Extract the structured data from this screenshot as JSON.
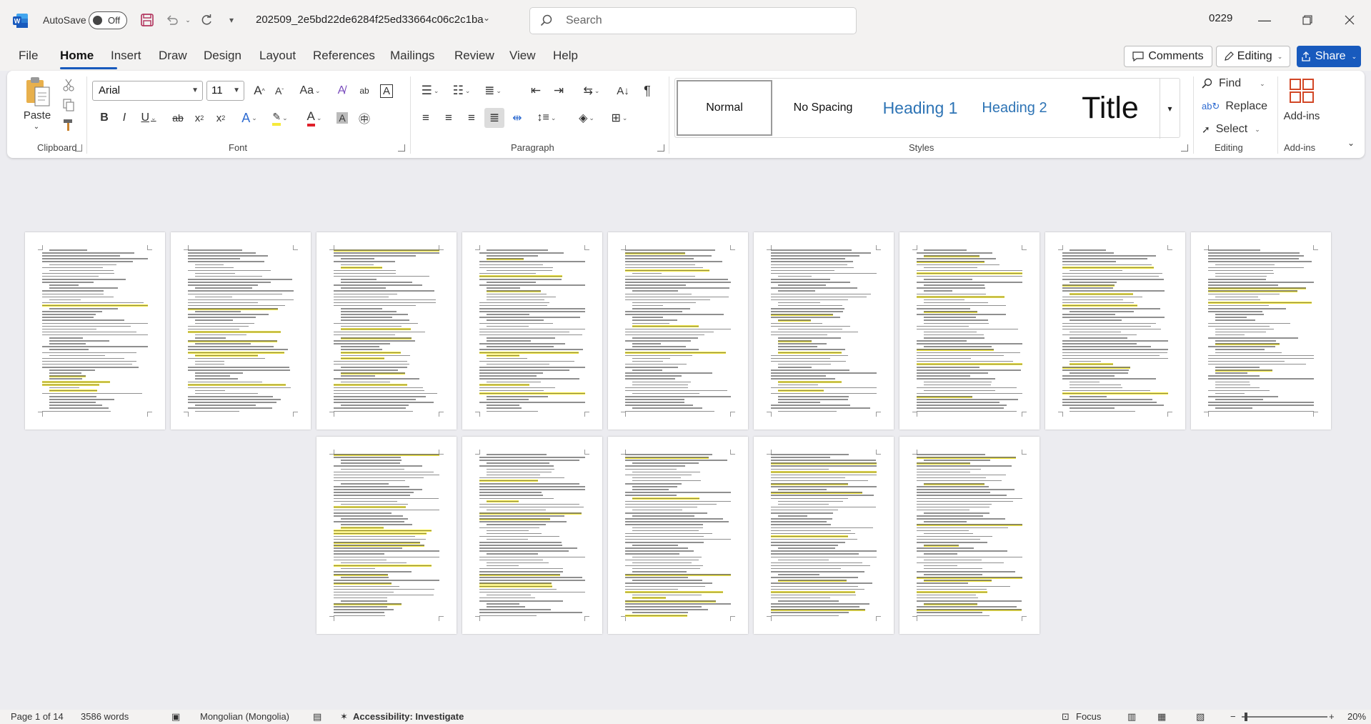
{
  "titlebar": {
    "autosave_label": "AutoSave",
    "autosave_state": "Off",
    "document_name": "202509_2e5bd22de6284f25ed33664c06c2c1ba",
    "search_placeholder": "Search",
    "user": "0229"
  },
  "menu": {
    "tabs": [
      "File",
      "Home",
      "Insert",
      "Draw",
      "Design",
      "Layout",
      "References",
      "Mailings",
      "Review",
      "View",
      "Help"
    ],
    "active_tab": "Home",
    "comments_label": "Comments",
    "editing_label": "Editing",
    "share_label": "Share"
  },
  "ribbon": {
    "clipboard": {
      "paste_label": "Paste",
      "group_label": "Clipboard"
    },
    "font": {
      "font_name": "Arial",
      "font_size": "11",
      "group_label": "Font"
    },
    "paragraph": {
      "group_label": "Paragraph"
    },
    "styles": {
      "items": [
        "Normal",
        "No Spacing",
        "Heading 1",
        "Heading 2",
        "Title"
      ],
      "selected": "Normal",
      "group_label": "Styles"
    },
    "editing": {
      "find_label": "Find",
      "replace_label": "Replace",
      "select_label": "Select",
      "group_label": "Editing"
    },
    "addins": {
      "label": "Add-ins",
      "group_label": "Add-ins"
    }
  },
  "document": {
    "page_count": 14
  },
  "status": {
    "page": "Page 1 of 14",
    "words": "3586 words",
    "language": "Mongolian (Mongolia)",
    "accessibility": "Accessibility: Investigate",
    "focus": "Focus",
    "zoom": "20%"
  },
  "colors": {
    "accent": "#185abd",
    "highlight": "#f6ea3a",
    "word_blue": "#185abd"
  }
}
